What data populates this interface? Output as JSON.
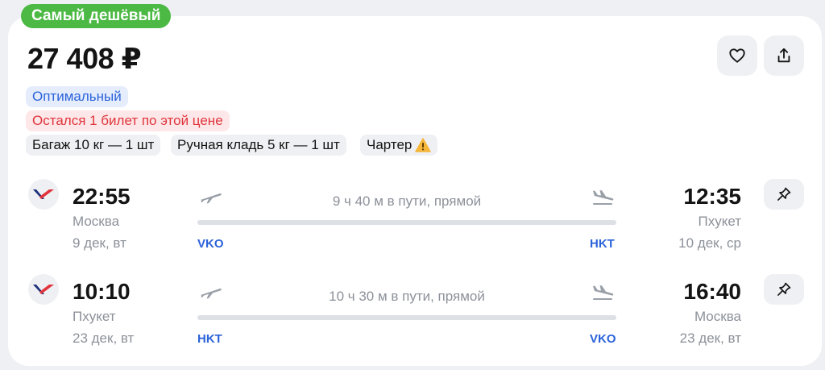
{
  "badge": "Самый дешёвый",
  "price": "27 408 ₽",
  "tags": {
    "optimal": "Оптимальный",
    "seats_left": "Остался 1 билет по этой цене",
    "baggage": "Багаж 10 кг — 1 шт",
    "hand_luggage": "Ручная кладь 5 кг — 1 шт",
    "charter": "Чартер"
  },
  "icons": [
    "heart-icon",
    "share-icon",
    "pin-icon",
    "takeoff-icon",
    "landing-icon",
    "warning-icon",
    "airline-logo"
  ],
  "colors": {
    "badge_green": "#4cb944",
    "accent_blue": "#2b63d9",
    "alert_red": "#e0353d"
  },
  "flights": [
    {
      "dep_time": "22:55",
      "dep_city": "Москва",
      "dep_date": "9 дек, вт",
      "dep_code": "VKO",
      "duration": "9 ч 40 м в пути, прямой",
      "arr_time": "12:35",
      "arr_city": "Пхукет",
      "arr_date": "10 дек, ср",
      "arr_code": "HKT"
    },
    {
      "dep_time": "10:10",
      "dep_city": "Пхукет",
      "dep_date": "23 дек, вт",
      "dep_code": "HKT",
      "duration": "10 ч 30 м в пути, прямой",
      "arr_time": "16:40",
      "arr_city": "Москва",
      "arr_date": "23 дек, вт",
      "arr_code": "VKO"
    }
  ]
}
